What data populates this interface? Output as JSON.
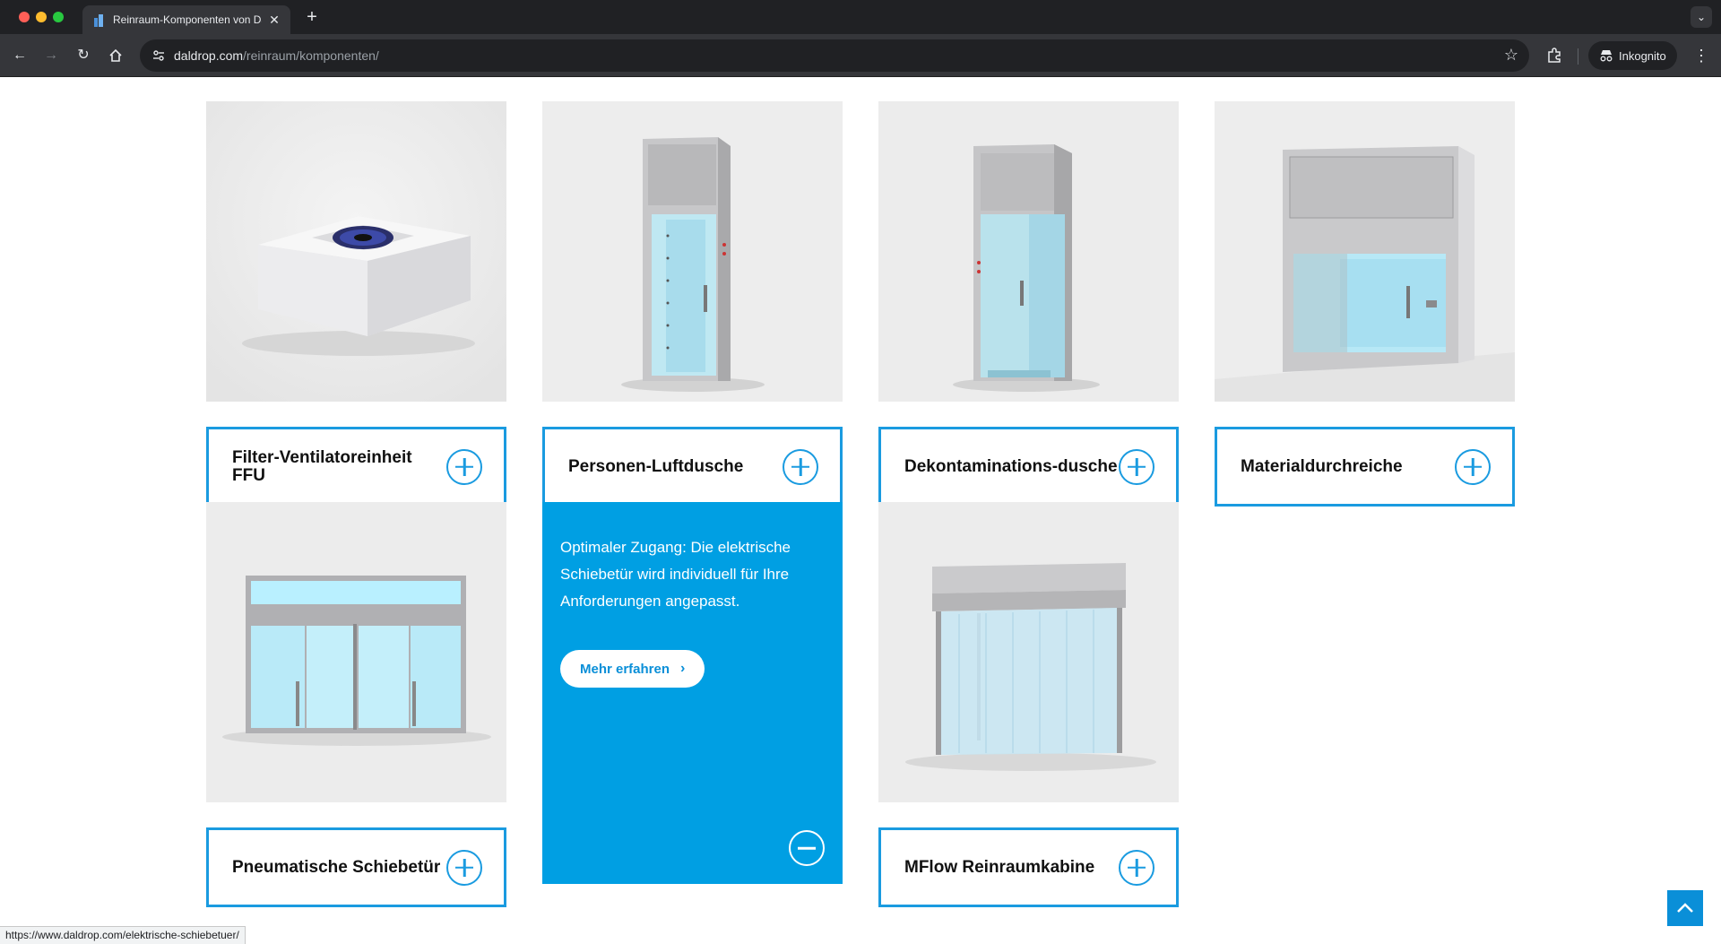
{
  "browser": {
    "tab_title": "Reinraum-Komponenten von Daldrop",
    "url_host": "daldrop.com",
    "url_path": "/reinraum/komponenten/",
    "incognito_label": "Inkognito",
    "status_url": "https://www.daldrop.com/elektrische-schiebetuer/"
  },
  "products": [
    {
      "label": "Filter-Ventilatoreinheit FFU",
      "icon": "ffu-unit-image"
    },
    {
      "label": "Personen-Luftdusche",
      "icon": "air-shower-image"
    },
    {
      "label": "Dekontaminations-dusche",
      "icon": "decontamination-shower-image"
    },
    {
      "label": "Materialdurchreiche",
      "icon": "pass-box-image"
    },
    {
      "label": "Pneumatische Schiebetür",
      "icon": "sliding-door-image"
    },
    {
      "label": "MFlow Reinraumkabine",
      "icon": "cleanroom-cabin-image"
    }
  ],
  "promo": {
    "text": "Optimaler Zugang: Die elektrische Schiebetür wird individuell für Ihre Anforderungen angepasst.",
    "button_label": "Mehr erfahren"
  },
  "colors": {
    "accent": "#1a9be0",
    "promo_bg": "#009fe3"
  }
}
